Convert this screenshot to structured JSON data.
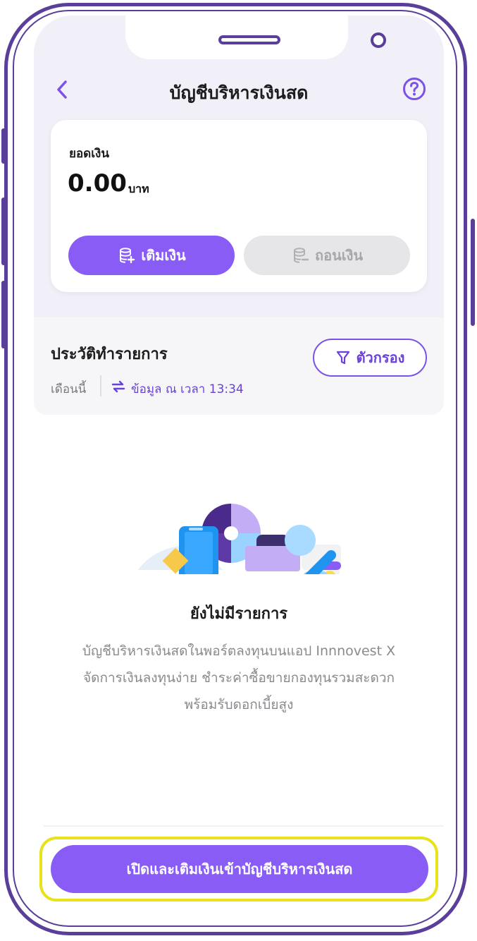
{
  "header": {
    "title": "บัญชีบริหารเงินสด",
    "back_icon": "chevron-left-icon",
    "help_icon": "question-circle-icon"
  },
  "balance": {
    "label": "ยอดเงิน",
    "amount": "0.00",
    "unit": "บาท",
    "topup_label": "เติมเงิน",
    "withdraw_label": "ถอนเงิน"
  },
  "history": {
    "title": "ประวัติทำรายการ",
    "filter_label": "ตัวกรอง",
    "period": "เดือนนี้",
    "updated": "ข้อมูล ณ เวลา 13:34"
  },
  "empty": {
    "title": "ยังไม่มีรายการ",
    "line1": "บัญชีบริหารเงินสดในพอร์ตลงทุนบนแอป Innnovest X",
    "line2": "จัดการเงินลงทุนง่าย ชำระค่าซื้อขายกองทุนรวมสะดวก",
    "line3": "พร้อมรับดอกเบี้ยสูง"
  },
  "cta": {
    "label": "เปิดและเติมเงินเข้าบัญชีบริหารเงินสด"
  },
  "colors": {
    "accent": "#8a5cf6",
    "frame": "#5a3f9a",
    "highlight": "#e8e21a"
  }
}
